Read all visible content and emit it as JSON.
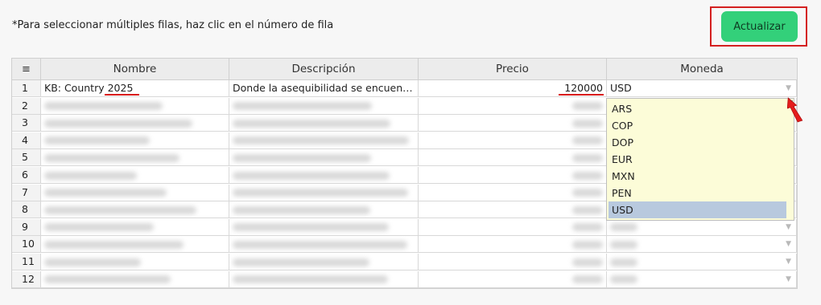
{
  "hint": "*Para seleccionar múltiples filas, haz clic en el número de fila",
  "update_button": "Actualizar",
  "columns": {
    "menu_icon": "≡",
    "nombre": "Nombre",
    "descripcion": "Descripción",
    "precio": "Precio",
    "moneda": "Moneda"
  },
  "rows": [
    {
      "num": "1",
      "nombre": "KB: Country 2025",
      "descripcion": "Donde la asequibilidad se encuen…",
      "precio": "120000",
      "moneda": "USD"
    },
    {
      "num": "2",
      "nombre": "",
      "descripcion": "",
      "precio": "",
      "moneda": ""
    },
    {
      "num": "3",
      "nombre": "",
      "descripcion": "",
      "precio": "",
      "moneda": ""
    },
    {
      "num": "4",
      "nombre": "",
      "descripcion": "",
      "precio": "",
      "moneda": ""
    },
    {
      "num": "5",
      "nombre": "",
      "descripcion": "",
      "precio": "",
      "moneda": ""
    },
    {
      "num": "6",
      "nombre": "",
      "descripcion": "",
      "precio": "",
      "moneda": ""
    },
    {
      "num": "7",
      "nombre": "",
      "descripcion": "",
      "precio": "",
      "moneda": ""
    },
    {
      "num": "8",
      "nombre": "",
      "descripcion": "",
      "precio": "",
      "moneda": ""
    },
    {
      "num": "9",
      "nombre": "",
      "descripcion": "",
      "precio": "",
      "moneda": ""
    },
    {
      "num": "10",
      "nombre": "",
      "descripcion": "",
      "precio": "",
      "moneda": ""
    },
    {
      "num": "11",
      "nombre": "",
      "descripcion": "",
      "precio": "",
      "moneda": ""
    },
    {
      "num": "12",
      "nombre": "",
      "descripcion": "",
      "precio": "",
      "moneda": ""
    }
  ],
  "currency_options": [
    "ARS",
    "COP",
    "DOP",
    "EUR",
    "MXN",
    "PEN",
    "USD"
  ],
  "selected_currency": "USD",
  "dropdown_arrow": "▼",
  "colors": {
    "button_bg": "#33d07a",
    "highlight_border": "#d41f1f",
    "dropdown_bg": "#fcfcd8",
    "selected_option_bg": "#b8c9de"
  }
}
